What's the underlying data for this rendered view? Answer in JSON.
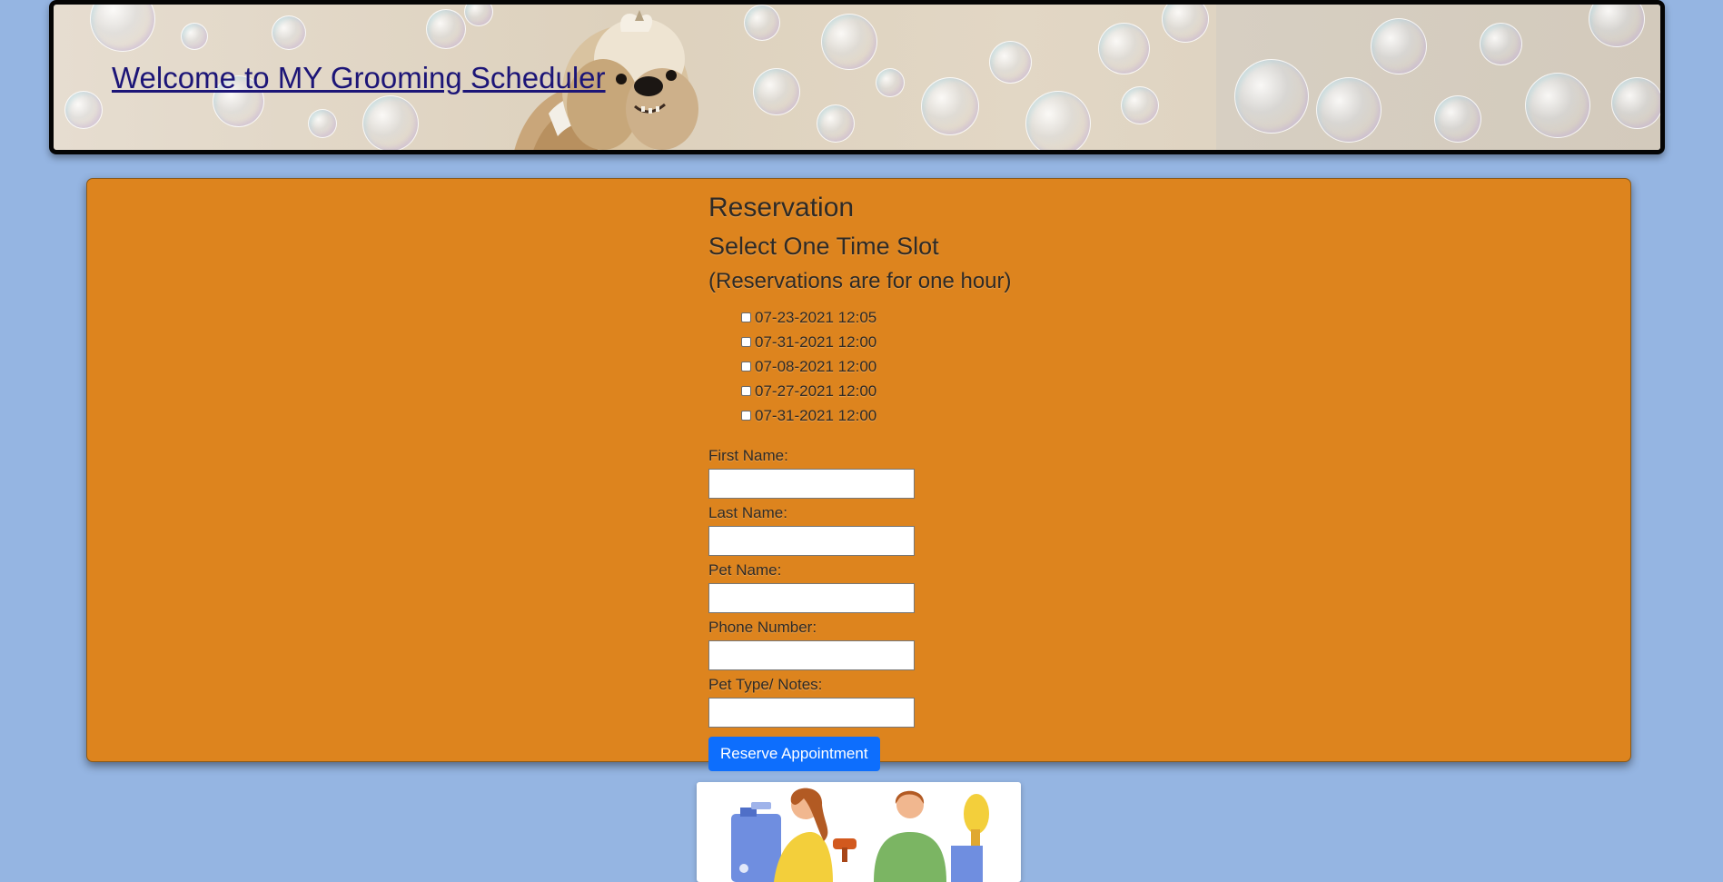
{
  "header": {
    "title": "Welcome to MY Grooming Scheduler"
  },
  "reservation": {
    "heading": "Reservation",
    "subheading": "Select One Time Slot",
    "note": "(Reservations are for one hour)",
    "time_slots": [
      {
        "label": "07-23-2021 12:05",
        "checked": false
      },
      {
        "label": "07-31-2021 12:00",
        "checked": false
      },
      {
        "label": "07-08-2021 12:00",
        "checked": false
      },
      {
        "label": "07-27-2021 12:00",
        "checked": false
      },
      {
        "label": "07-31-2021 12:00",
        "checked": false
      }
    ],
    "fields": {
      "first_name": {
        "label": "First Name:",
        "value": ""
      },
      "last_name": {
        "label": "Last Name:",
        "value": ""
      },
      "pet_name": {
        "label": "Pet Name:",
        "value": ""
      },
      "phone": {
        "label": "Phone Number:",
        "value": ""
      },
      "pet_type": {
        "label": "Pet Type/ Notes:",
        "value": ""
      }
    },
    "submit_label": "Reserve Appointment"
  },
  "colors": {
    "page_background": "#95b5e2",
    "card_background": "#dd841e",
    "button": "#0d6efd",
    "title_link": "#1c1577"
  },
  "icons": {
    "banner_image": "dog-with-bubbles-photo",
    "footer_image": "pet-groomers-illustration"
  }
}
